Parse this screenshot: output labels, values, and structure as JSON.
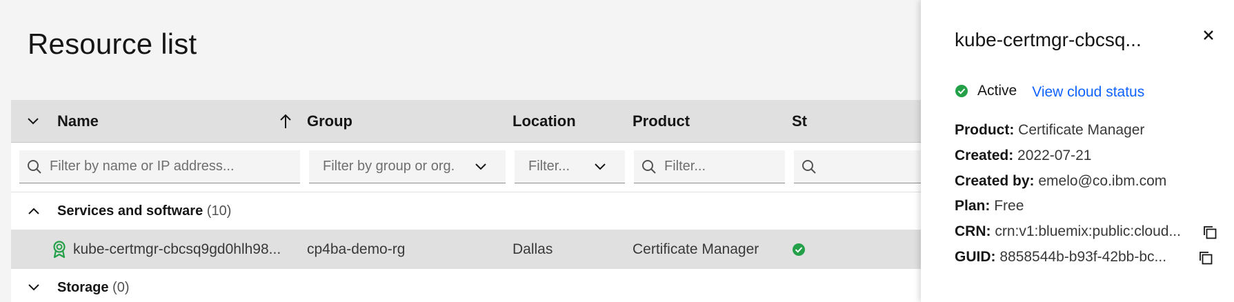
{
  "page": {
    "title": "Resource list"
  },
  "table": {
    "columns": {
      "name": "Name",
      "group": "Group",
      "location": "Location",
      "product": "Product",
      "status": "St"
    },
    "filters": {
      "name_placeholder": "Filter by name or IP address...",
      "group_placeholder": "Filter by group or org.",
      "location_placeholder": "Filter...",
      "product_placeholder": "Filter..."
    },
    "groups": [
      {
        "label": "Services and software",
        "count": "(10)"
      },
      {
        "label": "Storage",
        "count": "(0)"
      }
    ],
    "rows": [
      {
        "name": "kube-certmgr-cbcsq9gd0hlh98...",
        "group": "cp4ba-demo-rg",
        "location": "Dallas",
        "product": "Certificate Manager"
      }
    ]
  },
  "panel": {
    "title": "kube-certmgr-cbcsq...",
    "status": "Active",
    "status_link": "View cloud status",
    "properties": [
      {
        "key": "Product:",
        "value": "Certificate Manager"
      },
      {
        "key": "Created:",
        "value": "2022-07-21"
      },
      {
        "key": "Created by:",
        "value": "emelo@co.ibm.com"
      },
      {
        "key": "Plan:",
        "value": "Free"
      },
      {
        "key": "CRN:",
        "value": "crn:v1:bluemix:public:cloud..."
      },
      {
        "key": "GUID:",
        "value": "8858544b-b93f-42bb-bc..."
      }
    ]
  },
  "colors": {
    "link": "#0f62fe",
    "success": "#24a148",
    "header_bg": "#e0e0e0"
  },
  "icons": [
    "chevron-down-icon",
    "sort-arrow-up-icon",
    "search-icon",
    "chevron-up-icon",
    "certificate-manager-icon",
    "checkmark-filled-icon",
    "close-icon",
    "copy-icon"
  ]
}
